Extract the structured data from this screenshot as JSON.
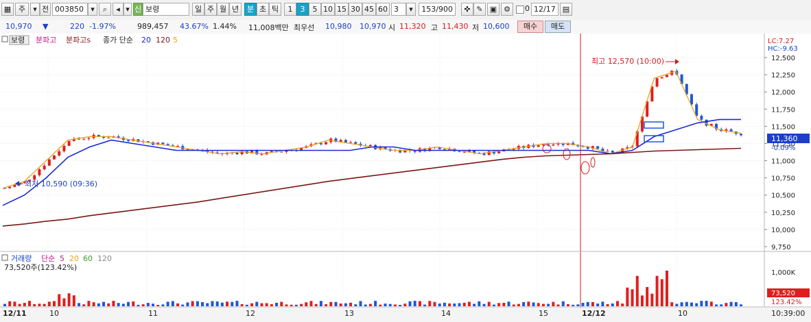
{
  "toolbar": {
    "market": "주",
    "market2": "전",
    "code": "003850",
    "stock_badge": "신",
    "stock_name": "보령",
    "periods": [
      "일",
      "주",
      "월",
      "년",
      "분",
      "초",
      "틱"
    ],
    "intervals": [
      "1",
      "3",
      "5",
      "10",
      "15",
      "30",
      "45",
      "60"
    ],
    "selected_interval": "3",
    "count": "153",
    "count_total": "/900",
    "date_label": "0",
    "date": "12/17"
  },
  "info": {
    "price": "10,970",
    "change": "220",
    "change_pct": "-1.97%",
    "volume": "989,457",
    "turnover_pct": "43.67%",
    "pct2": "1.44%",
    "amount": "11,008백만",
    "best_label": "최우선",
    "ask": "10,980",
    "bid": "10,970",
    "open_label": "시",
    "open": "11,320",
    "high_label": "고",
    "high": "11,430",
    "low_label": "저",
    "low": "10,600",
    "buy_label": "매수",
    "sell_label": "매도"
  },
  "legend": {
    "stock_tag": "보령",
    "ind1": "분파고",
    "ind2": "분파고s",
    "ma_label": "종가 단순",
    "ma_periods": [
      "20",
      "120",
      "5"
    ],
    "lc": "LC:7.27",
    "hc": "HC:-9.63",
    "max_note": "최고 12,570 (10:00)",
    "min_note": "최저 10,590 (09:36)",
    "price_tag": "11,360",
    "price_tag_pct": "-0.09%"
  },
  "volume": {
    "title": "거래량",
    "ma_label": "단순",
    "ma_periods": [
      "5",
      "20",
      "60",
      "120"
    ],
    "current": "73,520주(123.42%)",
    "tag_value": "73,520",
    "tag_pct": "123.42%",
    "axis_label": "1,000K"
  },
  "time_axis": {
    "labels": [
      "12/11",
      "10",
      "11",
      "12",
      "13",
      "14",
      "15",
      "12/12",
      "10",
      "10:39:00"
    ]
  },
  "colors": {
    "up": "#e01e1e",
    "down": "#1e58d8",
    "ma5": "#e8a21a",
    "ma20": "#1a28d6",
    "ma120": "#7a1616",
    "accent": "#19a3c8"
  },
  "chart_data": {
    "type": "candlestick",
    "y_ticks": [
      "12,500",
      "12,250",
      "12,000",
      "11,750",
      "11,500",
      "11,250",
      "11,000",
      "10,750",
      "10,500",
      "10,250",
      "10,000",
      "9,750"
    ],
    "ylim": [
      9700,
      12650
    ],
    "series": [
      {
        "name": "5",
        "values": [
          10600,
          10700,
          11000,
          11300,
          11350,
          11350,
          11300,
          11250,
          11200,
          11150,
          11100,
          11130,
          11100,
          11150,
          11200,
          11300,
          11250,
          11200,
          11150,
          11150,
          11200,
          11150,
          11100,
          11150,
          11200,
          11250,
          11250,
          11200,
          11100,
          11200,
          12200,
          12300,
          11600,
          11450,
          11400
        ]
      },
      {
        "name": "20",
        "values": [
          10350,
          10500,
          10750,
          11050,
          11200,
          11300,
          11250,
          11200,
          11150,
          11150,
          11150,
          11150,
          11150,
          11150,
          11150,
          11150,
          11150,
          11200,
          11200,
          11150,
          11150,
          11150,
          11150,
          11150,
          11150,
          11150,
          11150,
          11150,
          11100,
          11150,
          11350,
          11450,
          11550,
          11600,
          11600
        ]
      },
      {
        "name": "120",
        "values": [
          10050,
          10080,
          10120,
          10150,
          10200,
          10240,
          10280,
          10320,
          10360,
          10400,
          10450,
          10500,
          10550,
          10600,
          10650,
          10700,
          10740,
          10780,
          10820,
          10860,
          10900,
          10940,
          10980,
          11020,
          11050,
          11070,
          11080,
          11090,
          11100,
          11120,
          11140,
          11150,
          11160,
          11170,
          11180
        ]
      }
    ]
  }
}
